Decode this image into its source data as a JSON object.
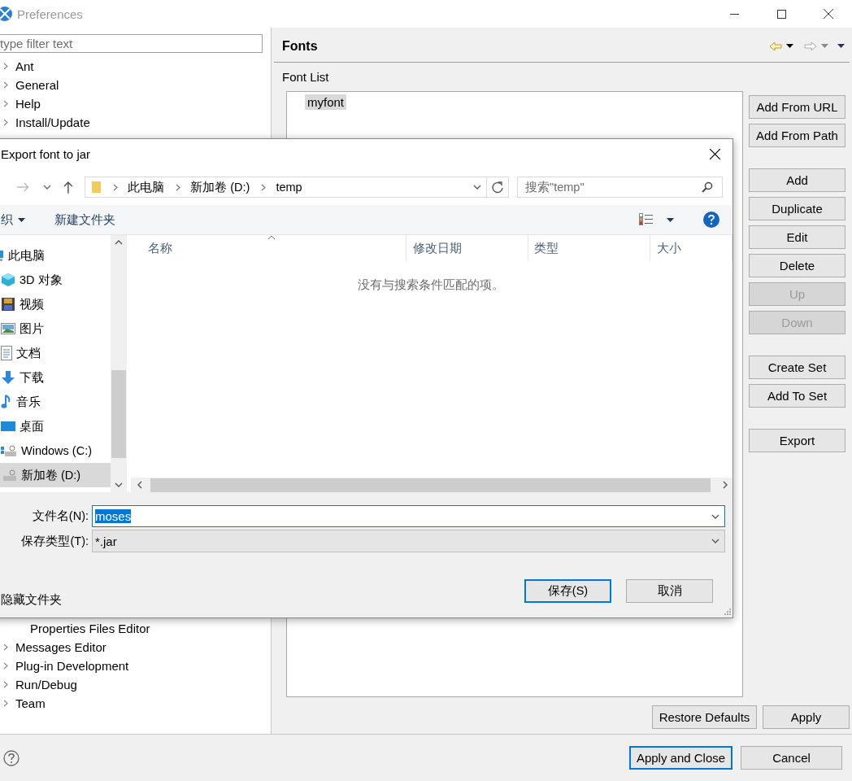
{
  "window": {
    "title": "Preferences"
  },
  "filter": {
    "placeholder": "type filter text"
  },
  "tree_top": [
    {
      "label": "Ant",
      "expanded": false
    },
    {
      "label": "General",
      "expanded": false
    },
    {
      "label": "Help",
      "expanded": false
    },
    {
      "label": "Install/Update",
      "expanded": false
    }
  ],
  "tree_bottom": [
    {
      "children": [
        {
          "label": "Properties Files Editor"
        }
      ]
    },
    {
      "label": "Messages Editor",
      "expanded": false
    },
    {
      "label": "Plug-in Development",
      "expanded": false
    },
    {
      "label": "Run/Debug",
      "expanded": false
    },
    {
      "label": "Team",
      "expanded": false
    }
  ],
  "page": {
    "title": "Fonts",
    "list_label": "Font List",
    "fonts": [
      {
        "label": "myfont",
        "selected": true
      }
    ],
    "button_groups": [
      {
        "buttons": [
          {
            "label": "Add From URL",
            "disabled": false
          },
          {
            "label": "Add From Path",
            "disabled": false
          }
        ]
      },
      {
        "buttons": [
          {
            "label": "Add",
            "disabled": false
          },
          {
            "label": "Duplicate",
            "disabled": false
          },
          {
            "label": "Edit",
            "disabled": false
          },
          {
            "label": "Delete",
            "disabled": false
          },
          {
            "label": "Up",
            "disabled": true
          },
          {
            "label": "Down",
            "disabled": true
          }
        ]
      },
      {
        "buttons": [
          {
            "label": "Create Set",
            "disabled": false
          },
          {
            "label": "Add To Set",
            "disabled": false
          }
        ]
      },
      {
        "buttons": [
          {
            "label": "Export",
            "disabled": false
          }
        ]
      }
    ],
    "footer_buttons": [
      {
        "label": "Restore Defaults"
      },
      {
        "label": "Apply"
      }
    ]
  },
  "bottom_buttons": [
    {
      "label": "Apply and Close",
      "default": true
    },
    {
      "label": "Cancel",
      "default": false
    }
  ],
  "dialog": {
    "title": "Export font to jar",
    "breadcrumb": [
      "此电脑",
      "新加卷 (D:)",
      "temp"
    ],
    "search": {
      "placeholder": "搜索\"temp\""
    },
    "organize": "织",
    "new_folder": "新建文件夹",
    "nav_items": [
      {
        "label": "此电脑",
        "selected": false,
        "children": [
          {
            "label": "3D 对象",
            "selected": false
          },
          {
            "label": "视频",
            "selected": false
          },
          {
            "label": "图片",
            "selected": false
          },
          {
            "label": "文档",
            "selected": false
          },
          {
            "label": "下载",
            "selected": false
          },
          {
            "label": "音乐",
            "selected": false
          },
          {
            "label": "桌面",
            "selected": false
          },
          {
            "label": "Windows (C:)",
            "selected": false
          },
          {
            "label": "新加卷 (D:)",
            "selected": true
          }
        ]
      }
    ],
    "columns": [
      {
        "label": "名称",
        "sorted": true
      },
      {
        "label": "修改日期",
        "sorted": false
      },
      {
        "label": "类型",
        "sorted": false
      },
      {
        "label": "大小",
        "sorted": false
      }
    ],
    "empty_message": "没有与搜索条件匹配的项。",
    "file_name": {
      "label": "文件名(N):",
      "value": "moses",
      "value_selected": true
    },
    "file_type": {
      "label": "保存类型(T):",
      "value": "*.jar"
    },
    "hide_folders": "隐藏文件夹",
    "buttons": [
      {
        "label": "保存(S)",
        "default": true
      },
      {
        "label": "取消",
        "default": false
      }
    ]
  }
}
